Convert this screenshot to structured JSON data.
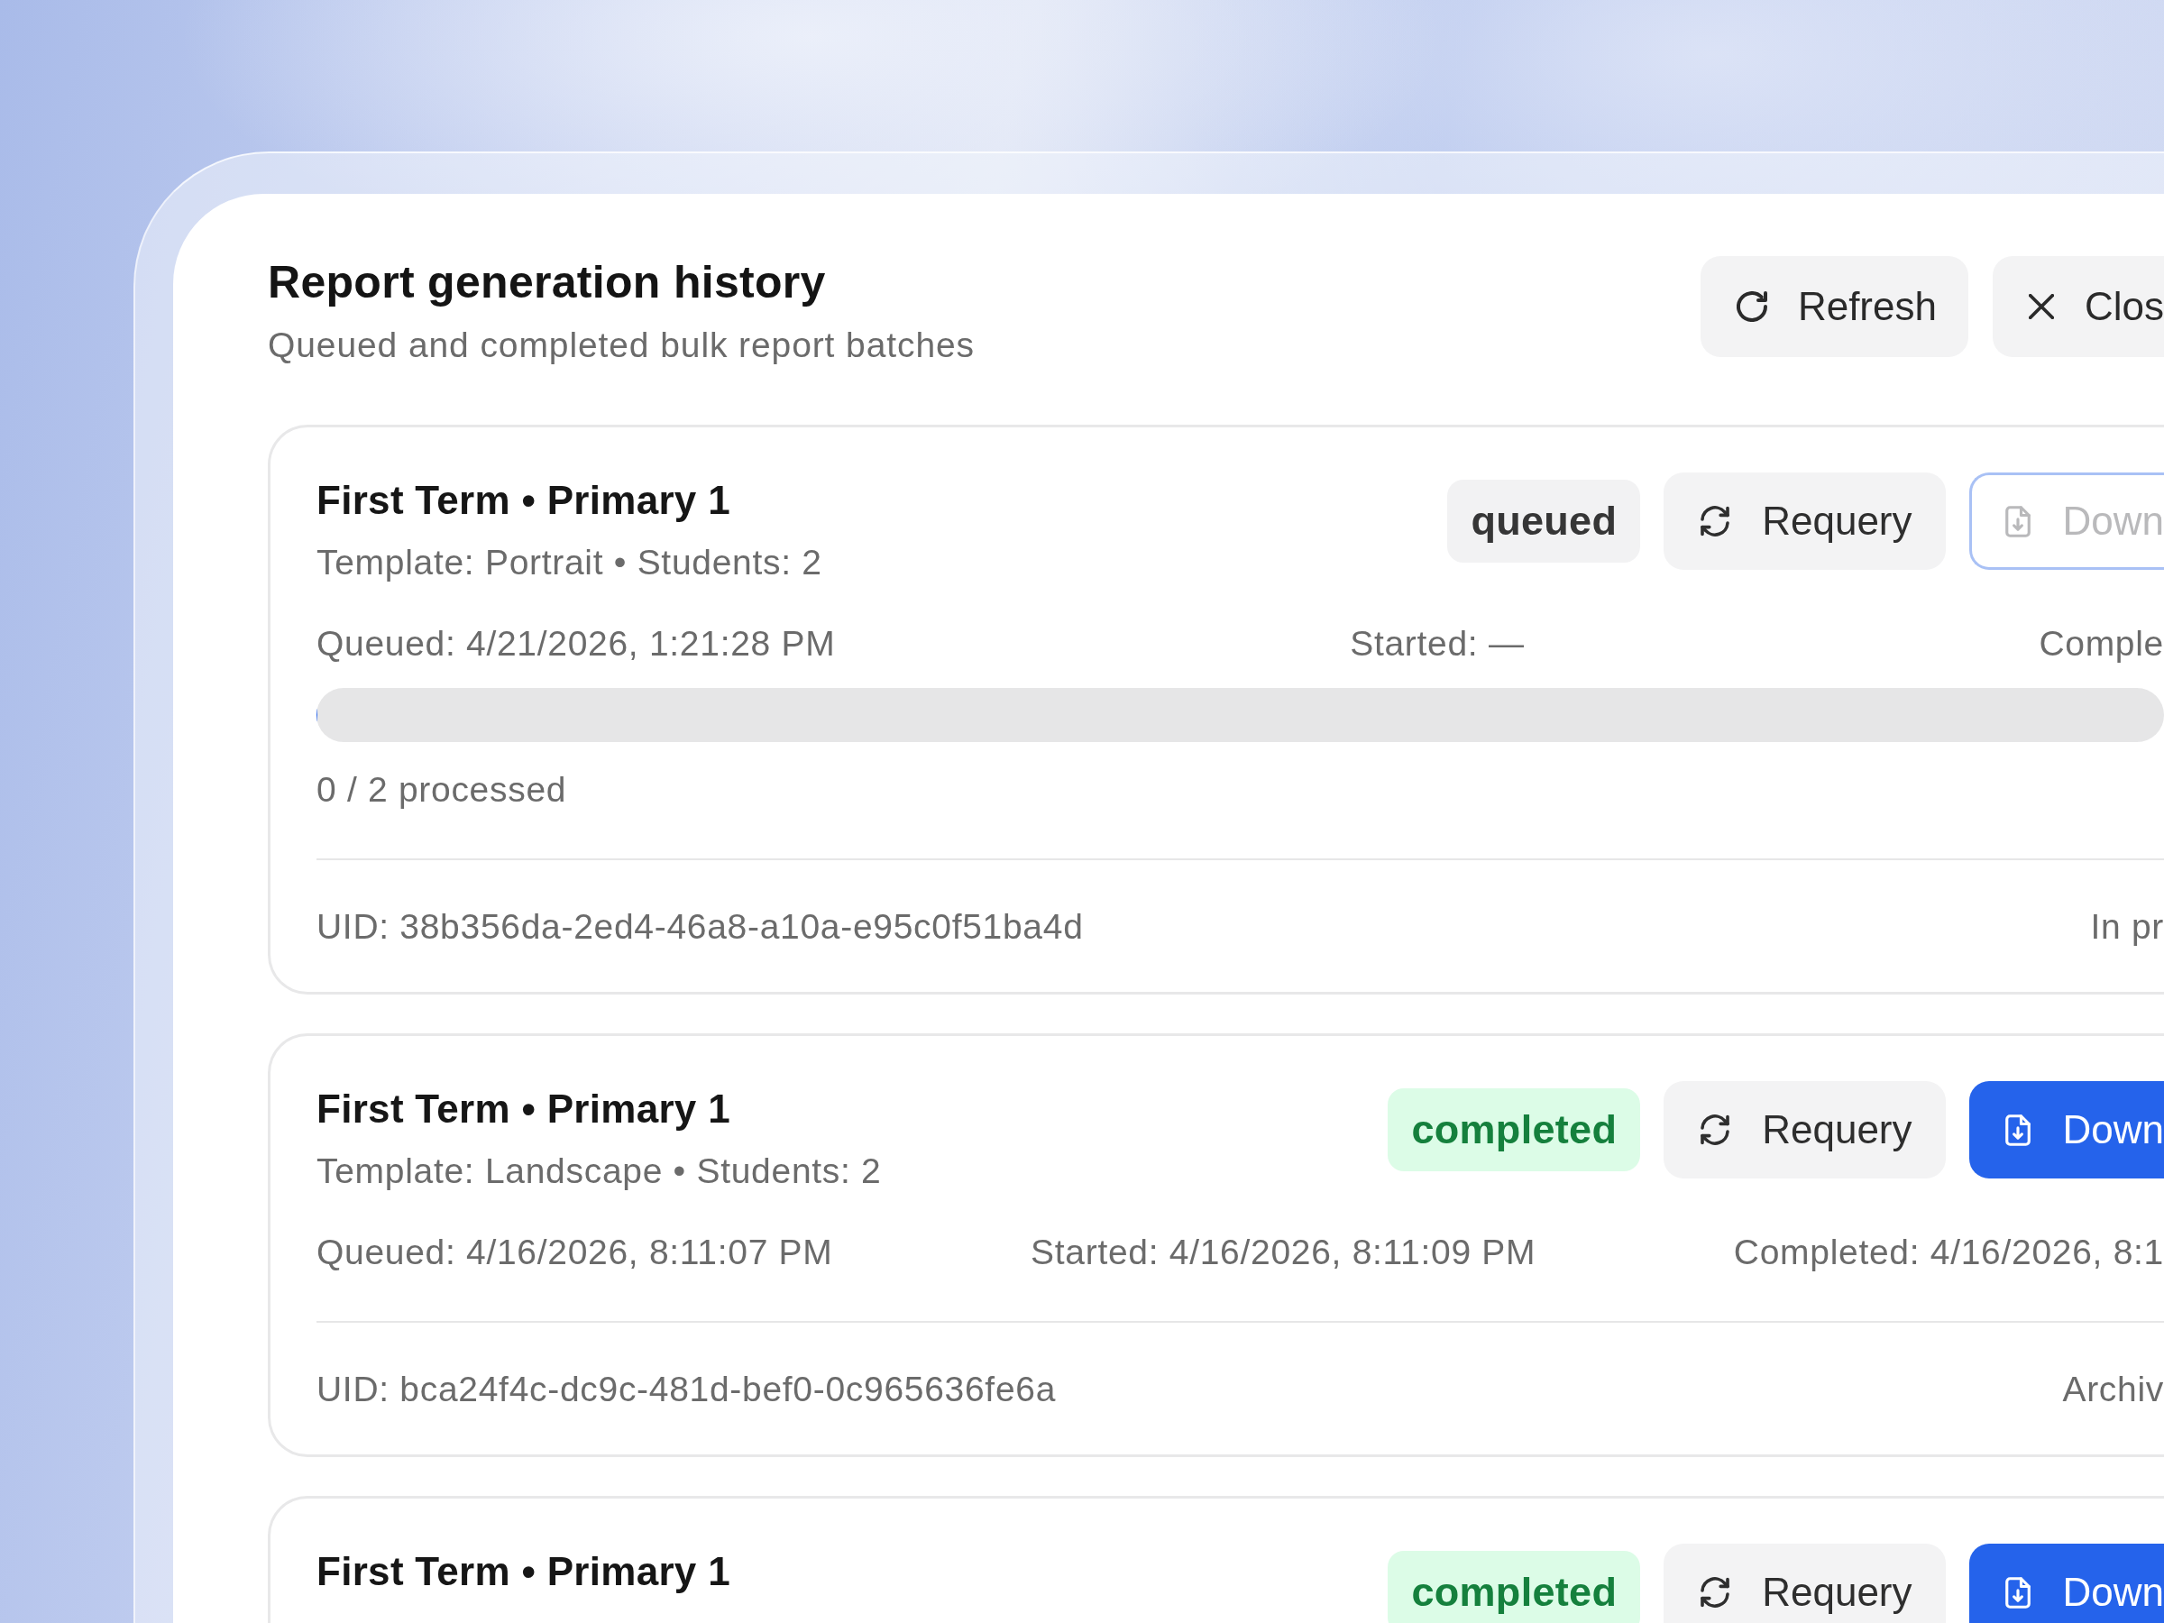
{
  "dialog": {
    "title": "Report generation history",
    "subtitle": "Queued and completed bulk report batches",
    "actions": [
      {
        "kind": "refresh",
        "label": "Refresh"
      },
      {
        "kind": "close",
        "label": "Clos"
      }
    ]
  },
  "batches": [
    {
      "title": "First Term • Primary 1",
      "details": "Template: Portrait • Students: 2",
      "badge": {
        "kind": "neutral",
        "label": "queued"
      },
      "requery": {
        "label": "Requery"
      },
      "download": {
        "label": "Down",
        "disabled": true
      },
      "times": [
        "Queued: 4/21/2026, 1:21:28 PM",
        "Started: —",
        "Comple"
      ],
      "progress": {
        "level": 0,
        "caption": "0 / 2 processed"
      },
      "uid": "UID: 38b356da-2ed4-46a8-a10a-e95c0f51ba4d",
      "note": "In pr"
    },
    {
      "title": "First Term • Primary 1",
      "details": "Template: Landscape • Students: 2",
      "badge": {
        "kind": "success",
        "label": "completed"
      },
      "requery": {
        "label": "Requery"
      },
      "download": {
        "label": "Down",
        "disabled": false
      },
      "times": [
        "Queued: 4/16/2026, 8:11:07 PM",
        "Started: 4/16/2026, 8:11:09 PM",
        "Completed: 4/16/2026, 8:1"
      ],
      "uid": "UID: bca24f4c-dc9c-481d-bef0-0c965636fe6a",
      "note": "Archiv"
    },
    {
      "title": "First Term • Primary 1",
      "badge": {
        "kind": "success",
        "label": "completed"
      },
      "requery": {
        "label": "Requery"
      },
      "download": {
        "label": "Down",
        "disabled": false
      }
    }
  ]
}
